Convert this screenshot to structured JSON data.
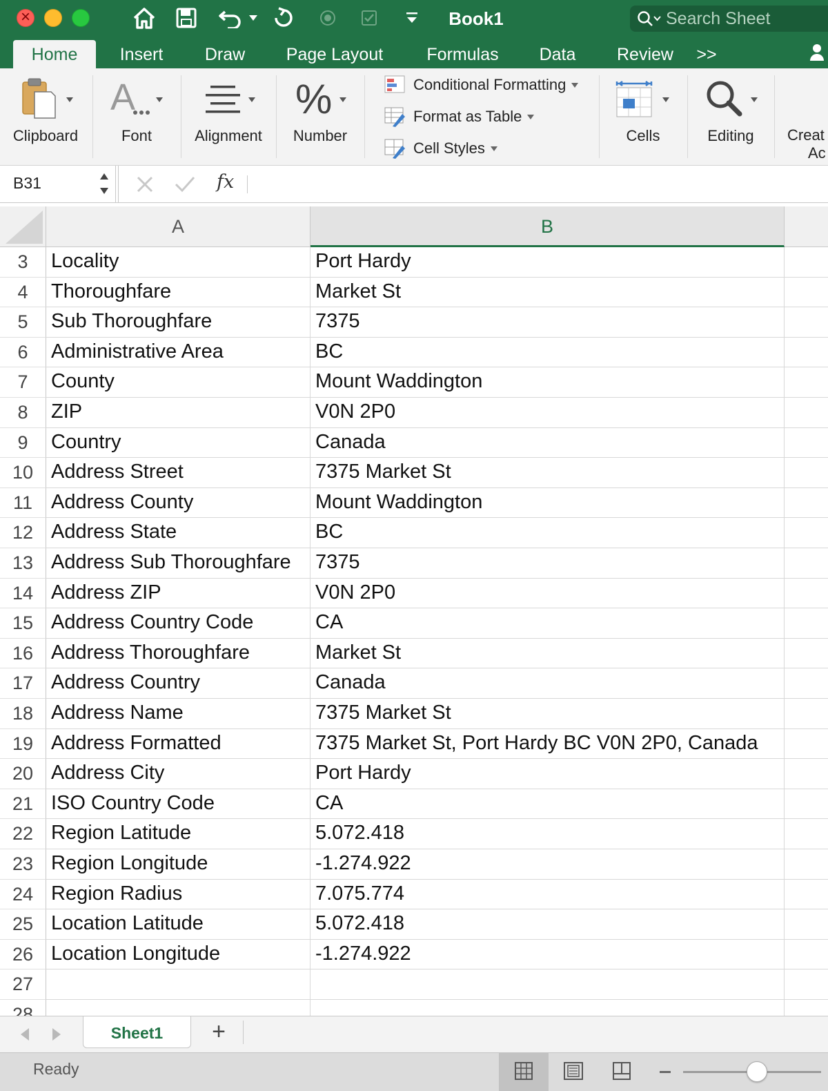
{
  "window": {
    "title": "Book1",
    "search_placeholder": "Search Sheet"
  },
  "tabs": [
    {
      "label": "Home",
      "active": true
    },
    {
      "label": "Insert"
    },
    {
      "label": "Draw"
    },
    {
      "label": "Page Layout"
    },
    {
      "label": "Formulas"
    },
    {
      "label": "Data"
    },
    {
      "label": "Review"
    },
    {
      "label": ">>"
    }
  ],
  "ribbon": {
    "clipboard": "Clipboard",
    "font": "Font",
    "alignment": "Alignment",
    "number": "Number",
    "number_icon": "%",
    "conditional_formatting": "Conditional Formatting",
    "format_as_table": "Format as Table",
    "cell_styles": "Cell Styles",
    "cells": "Cells",
    "editing": "Editing",
    "create_partial_1": "Creat",
    "create_partial_2": "Ac"
  },
  "formula_bar": {
    "name_box": "B31",
    "fx": "fx",
    "value": ""
  },
  "columns": [
    "A",
    "B"
  ],
  "selected_column": "B",
  "rows": [
    {
      "n": "3",
      "a": "Locality",
      "b": "Port Hardy"
    },
    {
      "n": "4",
      "a": "Thoroughfare",
      "b": "Market St"
    },
    {
      "n": "5",
      "a": "Sub Thoroughfare",
      "b": "7375"
    },
    {
      "n": "6",
      "a": "Administrative Area",
      "b": "BC"
    },
    {
      "n": "7",
      "a": "County",
      "b": "Mount Waddington"
    },
    {
      "n": "8",
      "a": "ZIP",
      "b": "V0N 2P0"
    },
    {
      "n": "9",
      "a": "Country",
      "b": "Canada"
    },
    {
      "n": "10",
      "a": "Address Street",
      "b": "7375 Market St"
    },
    {
      "n": "11",
      "a": "Address County",
      "b": "Mount Waddington"
    },
    {
      "n": "12",
      "a": "Address State",
      "b": "BC"
    },
    {
      "n": "13",
      "a": "Address Sub Thoroughfare",
      "b": "7375"
    },
    {
      "n": "14",
      "a": "Address ZIP",
      "b": "V0N 2P0"
    },
    {
      "n": "15",
      "a": "Address Country Code",
      "b": "CA"
    },
    {
      "n": "16",
      "a": "Address Thoroughfare",
      "b": "Market St"
    },
    {
      "n": "17",
      "a": "Address Country",
      "b": "Canada"
    },
    {
      "n": "18",
      "a": "Address Name",
      "b": "7375 Market St"
    },
    {
      "n": "19",
      "a": "Address Formatted",
      "b": "7375 Market St, Port Hardy BC V0N 2P0, Canada"
    },
    {
      "n": "20",
      "a": "Address City",
      "b": "Port Hardy"
    },
    {
      "n": "21",
      "a": "ISO Country Code",
      "b": "CA"
    },
    {
      "n": "22",
      "a": "Region Latitude",
      "b": "5.072.418"
    },
    {
      "n": "23",
      "a": "Region Longitude",
      "b": "-1.274.922"
    },
    {
      "n": "24",
      "a": "Region Radius",
      "b": "7.075.774"
    },
    {
      "n": "25",
      "a": "Location Latitude",
      "b": "5.072.418"
    },
    {
      "n": "26",
      "a": "Location Longitude",
      "b": "-1.274.922"
    },
    {
      "n": "27",
      "a": "",
      "b": ""
    },
    {
      "n": "28",
      "a": "",
      "b": ""
    }
  ],
  "sheets": [
    {
      "label": "Sheet1",
      "active": true
    }
  ],
  "add_sheet_label": "+",
  "status": {
    "text": "Ready"
  },
  "colors": {
    "accent": "#217346",
    "ribbon_bg": "#f3f3f3"
  },
  "icons": [
    "home-icon",
    "save-icon",
    "undo-icon",
    "redo-icon",
    "search-icon",
    "clipboard-icon",
    "font-icon",
    "alignment-icon",
    "cells-icon",
    "editing-search-icon",
    "normal-view-icon",
    "page-layout-view-icon",
    "page-break-view-icon"
  ]
}
